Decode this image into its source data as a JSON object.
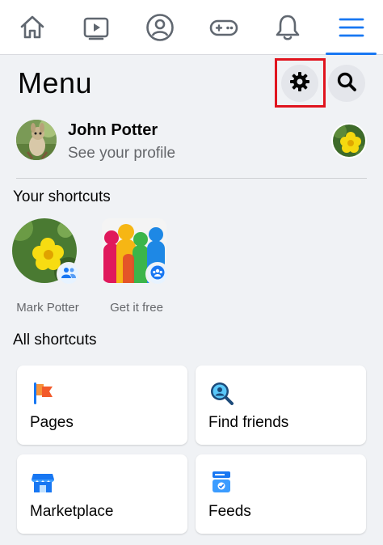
{
  "nav": {
    "tabs": [
      {
        "name": "home-icon",
        "active": false
      },
      {
        "name": "watch-icon",
        "active": false
      },
      {
        "name": "profile-icon",
        "active": false
      },
      {
        "name": "gaming-icon",
        "active": false
      },
      {
        "name": "notifications-icon",
        "active": false
      },
      {
        "name": "menu-icon",
        "active": true
      }
    ],
    "accent": "#1877f2"
  },
  "header": {
    "title": "Menu",
    "settings_icon": "gear-icon",
    "search_icon": "search-icon",
    "highlight_color": "#e0141e"
  },
  "profile": {
    "name": "John Potter",
    "subtitle": "See your profile"
  },
  "your_shortcuts": {
    "title": "Your shortcuts",
    "items": [
      {
        "label": "Mark Potter",
        "badge_icon": "friends-icon"
      },
      {
        "label": "Get it free",
        "badge_icon": "group-icon"
      }
    ]
  },
  "all_shortcuts": {
    "title": "All shortcuts",
    "items": [
      {
        "label": "Pages",
        "icon": "flag-icon"
      },
      {
        "label": "Find friends",
        "icon": "find-friends-icon"
      },
      {
        "label": "Marketplace",
        "icon": "marketplace-icon"
      },
      {
        "label": "Feeds",
        "icon": "feeds-icon"
      }
    ]
  }
}
